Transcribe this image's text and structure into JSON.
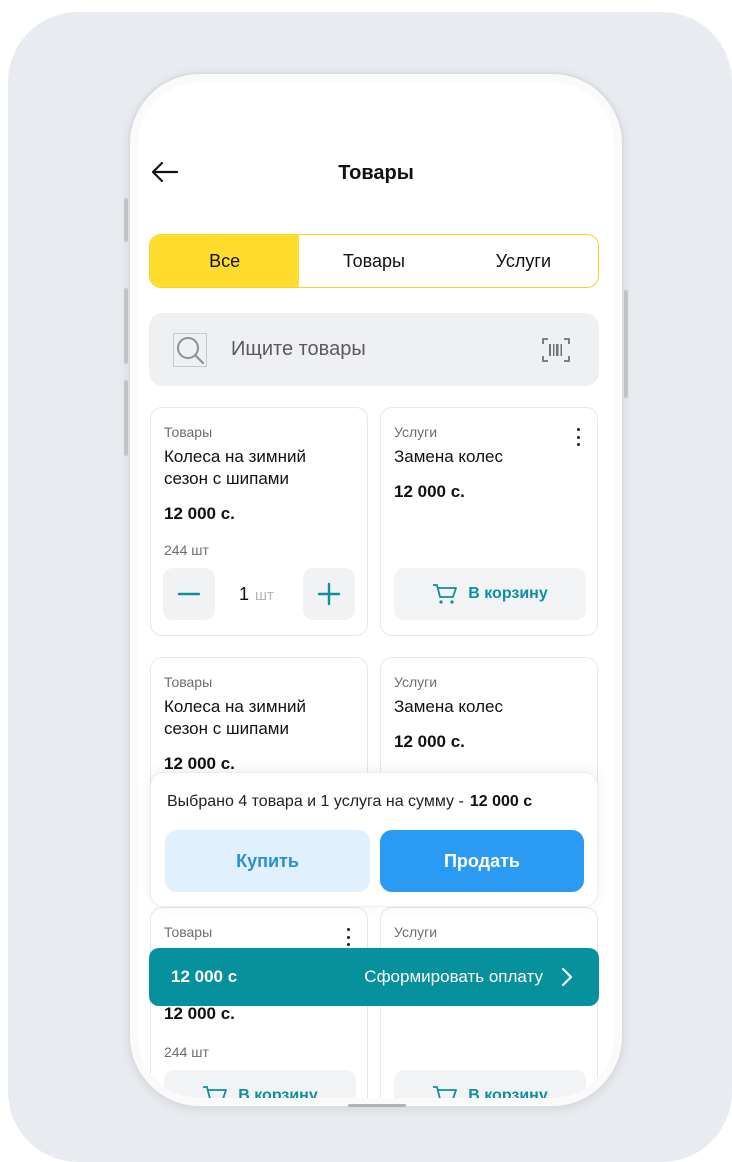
{
  "header": {
    "title": "Товары"
  },
  "tabs": [
    {
      "label": "Все",
      "active": true
    },
    {
      "label": "Товары",
      "active": false
    },
    {
      "label": "Услуги",
      "active": false
    }
  ],
  "search": {
    "placeholder": "Ищите товары"
  },
  "cards": [
    {
      "category": "Товары",
      "name": "Колеса на зимний сезон с шипами",
      "price": "12 000 с.",
      "stock": "244 шт",
      "quantity": "1",
      "unit": "шт"
    },
    {
      "category": "Услуги",
      "name": "Замена колес",
      "price": "12 000 с.",
      "cart_label": "В корзину"
    },
    {
      "category": "Товары",
      "name": "Колеса на зимний сезон с шипами",
      "price": "12 000 с."
    },
    {
      "category": "Услуги",
      "name": "Замена колес",
      "price": "12 000 с."
    },
    {
      "category": "Товары",
      "price": "12 000 с.",
      "stock": "244 шт",
      "cart_label": "В корзину"
    },
    {
      "category": "Услуги",
      "cart_label": "В корзину"
    }
  ],
  "summary": {
    "text": "Выбрано 4 товара и 1 услуга  на сумму -",
    "amount": "12 000 с",
    "buy_label": "Купить",
    "sell_label": "Продать"
  },
  "paybar": {
    "total": "12 000 с",
    "label": "Сформировать оплату"
  },
  "colors": {
    "accent_yellow": "#fedd2f",
    "teal": "#07919d",
    "blue": "#2b9af2",
    "light_blue": "#e0f0fd"
  },
  "icons": {
    "back": "arrow-left-icon",
    "search": "search-icon",
    "barcode": "barcode-scan-icon",
    "more": "more-vertical-icon",
    "minus": "minus-icon",
    "plus": "plus-icon",
    "cart": "cart-icon",
    "chevron": "chevron-right-icon"
  }
}
